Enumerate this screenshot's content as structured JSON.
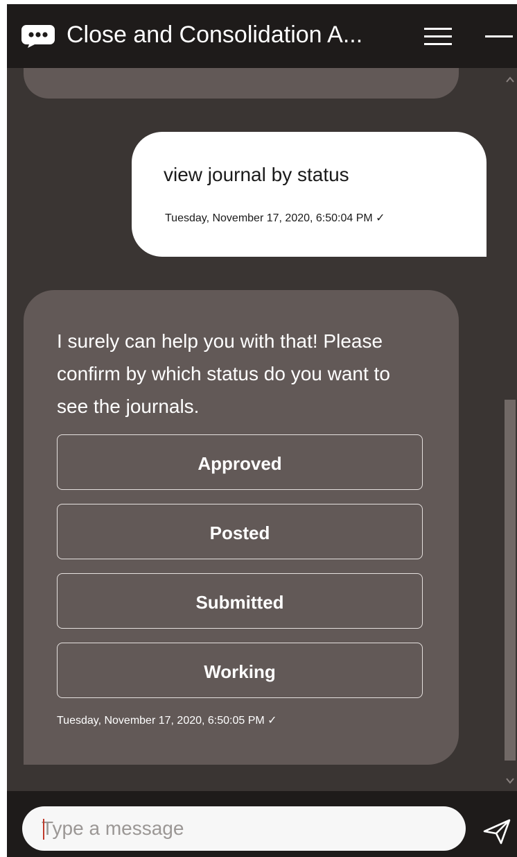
{
  "header": {
    "title": "Close and Consolidation A...",
    "chat_icon": "chat-bubble-icon",
    "menu_icon": "hamburger-menu-icon",
    "minimize_icon": "minimize-icon"
  },
  "messages": {
    "user": {
      "text": "view journal by status",
      "timestamp": "Tuesday, November 17, 2020, 6:50:04 PM ✓"
    },
    "bot": {
      "text": "I surely can help you with that! Please confirm by which status do you want to see the journals.",
      "options": [
        "Approved",
        "Posted",
        "Submitted",
        "Working"
      ],
      "timestamp": "Tuesday, November 17, 2020, 6:50:05 PM ✓"
    }
  },
  "footer": {
    "input_placeholder": "Type a message",
    "input_value": "",
    "send_icon": "send-icon"
  },
  "colors": {
    "header_bg": "#1e1b1a",
    "chat_bg": "#3a3533",
    "bot_bubble": "#625957",
    "user_bubble": "#ffffff"
  }
}
